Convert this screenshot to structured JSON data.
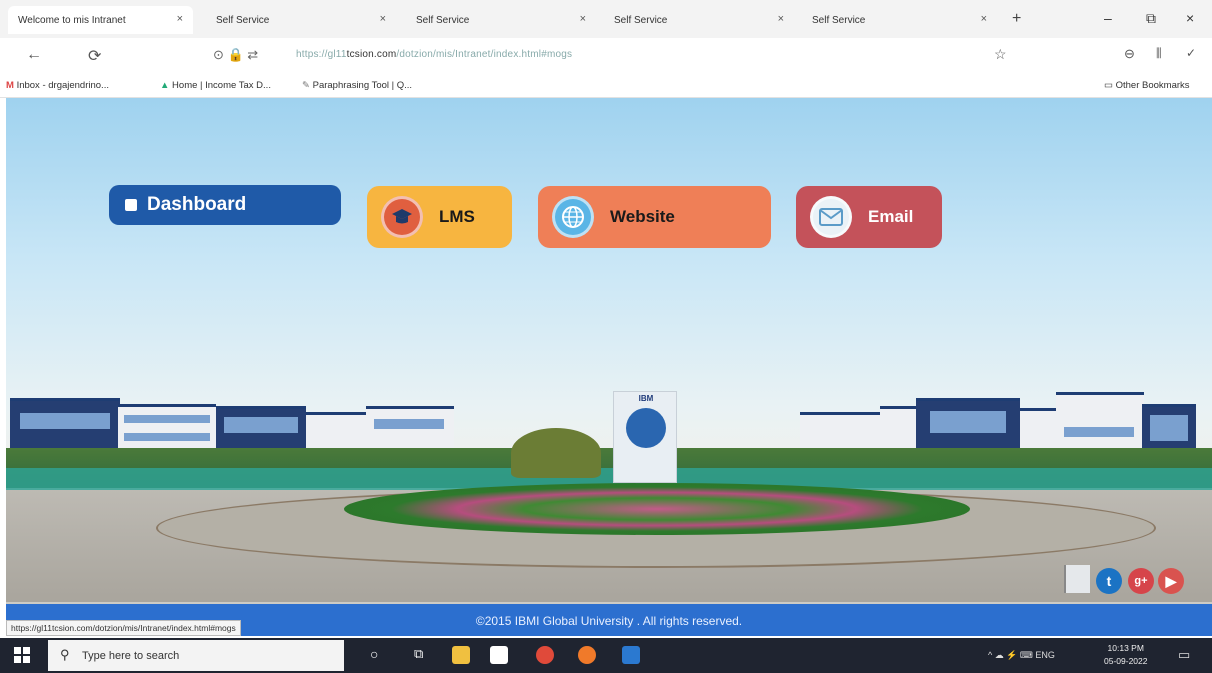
{
  "browser": {
    "tabs": [
      {
        "label": "Welcome to mis Intranet",
        "close": "×"
      },
      {
        "label": "Self Service",
        "close": "×"
      },
      {
        "label": "Self Service",
        "close": "×"
      },
      {
        "label": "Self Service",
        "close": "×"
      },
      {
        "label": "Self Service",
        "close": "×"
      }
    ],
    "new_tab": "+",
    "window_controls": {
      "minimize": "–",
      "restore": "⧉",
      "close": "×"
    },
    "nav": {
      "back": "←",
      "reload": "⟳"
    },
    "url_prefix": "https://gl11",
    "url_domain": "tcsion.com",
    "url_path": "/dotzion/mis/Intranet/index.html#mogs",
    "bookmarks": [
      "Inbox - drgajendrino...",
      "Home | Income Tax D...",
      "Paraphrasing Tool | Q..."
    ],
    "other_bookmarks": "Other Bookmarks"
  },
  "page": {
    "nav_buttons": {
      "dashboard": "Dashboard",
      "lms": "LMS",
      "website": "Website",
      "email": "Email"
    },
    "monument_text": "IBM",
    "footer_text": "©2015 IBMI Global University . All rights reserved."
  },
  "status_url": "https://gl11tcsion.com/dotzion/mis/Intranet/index.html#mogs",
  "taskbar": {
    "search_placeholder": "Type here to search",
    "tray": "^ ☁ ⚡ ⌨ ENG",
    "time": "10:13 PM",
    "date": "05-09-2022"
  },
  "colors": {
    "dashboard": "#1f5aa8",
    "lms": "#f7b540",
    "website": "#ef7f57",
    "email": "#c4525a",
    "footer": "#2c6fcf"
  }
}
